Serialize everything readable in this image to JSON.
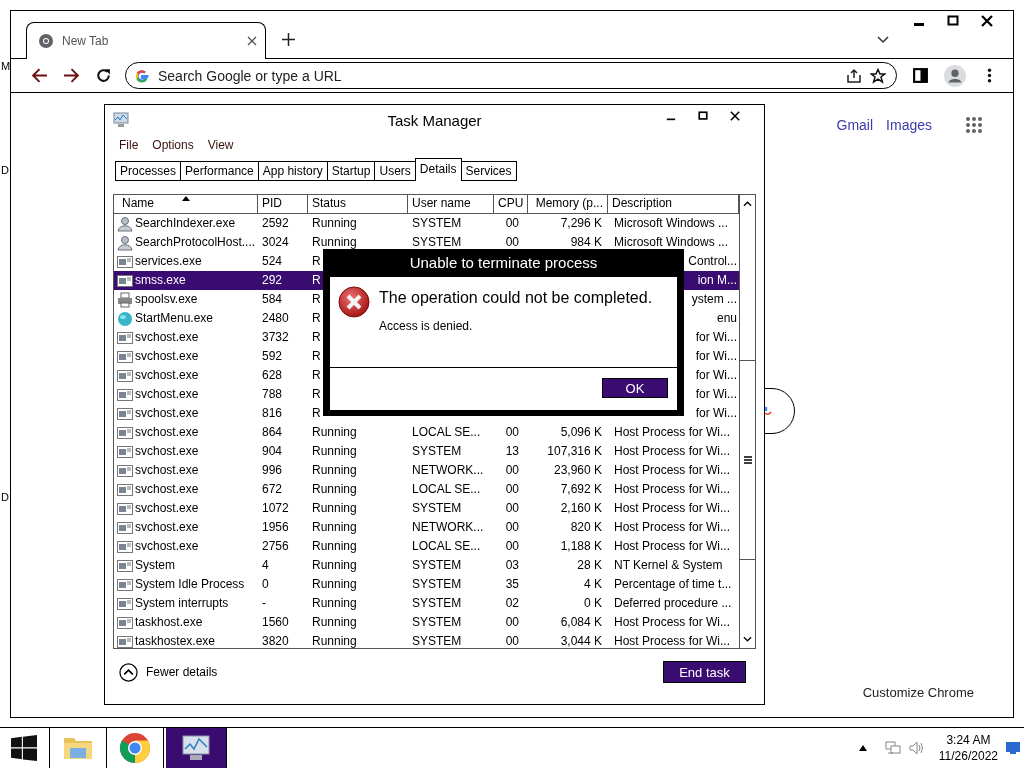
{
  "desktop": {
    "edge_letters": [
      "M",
      "D",
      "D"
    ]
  },
  "browser": {
    "tabs": [
      {
        "title": "New Tab",
        "selected": true
      }
    ],
    "omnibox": {
      "placeholder": "Search Google or type a URL"
    },
    "top_links": [
      "Gmail",
      "Images"
    ],
    "customize_button": "Customize Chrome"
  },
  "task_manager": {
    "title": "Task Manager",
    "menu": [
      "File",
      "Options",
      "View"
    ],
    "tabs": [
      {
        "label": "Processes",
        "selected": false
      },
      {
        "label": "Performance",
        "selected": false
      },
      {
        "label": "App history",
        "selected": false
      },
      {
        "label": "Startup",
        "selected": false
      },
      {
        "label": "Users",
        "selected": false
      },
      {
        "label": "Details",
        "selected": true
      },
      {
        "label": "Services",
        "selected": false
      }
    ],
    "columns": [
      {
        "label": "Name",
        "sorted": true
      },
      {
        "label": "PID",
        "sorted": false
      },
      {
        "label": "Status",
        "sorted": false
      },
      {
        "label": "User name",
        "sorted": false
      },
      {
        "label": "CPU",
        "sorted": false
      },
      {
        "label": "Memory (p...",
        "sorted": false
      },
      {
        "label": "Description",
        "sorted": false
      }
    ],
    "rows": [
      {
        "kind": "service",
        "name": "SearchIndexer.exe",
        "pid": "2592",
        "status": "Running",
        "user": "SYSTEM",
        "cpu": "00",
        "memory": "7,296 K",
        "description": "Microsoft Windows ...",
        "selected": false,
        "covered": false
      },
      {
        "kind": "service",
        "name": "SearchProtocolHost....",
        "pid": "3024",
        "status": "Running",
        "user": "SYSTEM",
        "cpu": "00",
        "memory": "984 K",
        "description": "Microsoft Windows ...",
        "selected": false,
        "covered": false
      },
      {
        "kind": "app",
        "name": "services.exe",
        "pid": "524",
        "status": "R",
        "description": "Control...",
        "selected": false,
        "covered": true
      },
      {
        "kind": "app",
        "name": "smss.exe",
        "pid": "292",
        "status": "R",
        "description": "ion M...",
        "selected": true,
        "covered": true
      },
      {
        "kind": "printer",
        "name": "spoolsv.exe",
        "pid": "584",
        "status": "R",
        "description": "ystem ...",
        "selected": false,
        "covered": true
      },
      {
        "kind": "globe",
        "name": "StartMenu.exe",
        "pid": "2480",
        "status": "R",
        "description": "enu",
        "selected": false,
        "covered": true
      },
      {
        "kind": "app",
        "name": "svchost.exe",
        "pid": "3732",
        "status": "R",
        "description": "for Wi...",
        "selected": false,
        "covered": true
      },
      {
        "kind": "app",
        "name": "svchost.exe",
        "pid": "592",
        "status": "R",
        "description": "for Wi...",
        "selected": false,
        "covered": true
      },
      {
        "kind": "app",
        "name": "svchost.exe",
        "pid": "628",
        "status": "R",
        "description": "for Wi...",
        "selected": false,
        "covered": true
      },
      {
        "kind": "app",
        "name": "svchost.exe",
        "pid": "788",
        "status": "R",
        "description": "for Wi...",
        "selected": false,
        "covered": true
      },
      {
        "kind": "app",
        "name": "svchost.exe",
        "pid": "816",
        "status": "R",
        "description": "for Wi...",
        "selected": false,
        "covered": true
      },
      {
        "kind": "app",
        "name": "svchost.exe",
        "pid": "864",
        "status": "Running",
        "user": "LOCAL SE...",
        "cpu": "00",
        "memory": "5,096 K",
        "description": "Host Process for Wi...",
        "selected": false,
        "covered": false
      },
      {
        "kind": "app",
        "name": "svchost.exe",
        "pid": "904",
        "status": "Running",
        "user": "SYSTEM",
        "cpu": "13",
        "memory": "107,316 K",
        "description": "Host Process for Wi...",
        "selected": false,
        "covered": false
      },
      {
        "kind": "app",
        "name": "svchost.exe",
        "pid": "996",
        "status": "Running",
        "user": "NETWORK...",
        "cpu": "00",
        "memory": "23,960 K",
        "description": "Host Process for Wi...",
        "selected": false,
        "covered": false
      },
      {
        "kind": "app",
        "name": "svchost.exe",
        "pid": "672",
        "status": "Running",
        "user": "LOCAL SE...",
        "cpu": "00",
        "memory": "7,692 K",
        "description": "Host Process for Wi...",
        "selected": false,
        "covered": false
      },
      {
        "kind": "app",
        "name": "svchost.exe",
        "pid": "1072",
        "status": "Running",
        "user": "SYSTEM",
        "cpu": "00",
        "memory": "2,160 K",
        "description": "Host Process for Wi...",
        "selected": false,
        "covered": false
      },
      {
        "kind": "app",
        "name": "svchost.exe",
        "pid": "1956",
        "status": "Running",
        "user": "NETWORK...",
        "cpu": "00",
        "memory": "820 K",
        "description": "Host Process for Wi...",
        "selected": false,
        "covered": false
      },
      {
        "kind": "app",
        "name": "svchost.exe",
        "pid": "2756",
        "status": "Running",
        "user": "LOCAL SE...",
        "cpu": "00",
        "memory": "1,188 K",
        "description": "Host Process for Wi...",
        "selected": false,
        "covered": false
      },
      {
        "kind": "app",
        "name": "System",
        "pid": "4",
        "status": "Running",
        "user": "SYSTEM",
        "cpu": "03",
        "memory": "28 K",
        "description": "NT Kernel & System",
        "selected": false,
        "covered": false
      },
      {
        "kind": "app",
        "name": "System Idle Process",
        "pid": "0",
        "status": "Running",
        "user": "SYSTEM",
        "cpu": "35",
        "memory": "4 K",
        "description": "Percentage of time t...",
        "selected": false,
        "covered": false
      },
      {
        "kind": "app",
        "name": "System interrupts",
        "pid": "-",
        "status": "Running",
        "user": "SYSTEM",
        "cpu": "02",
        "memory": "0 K",
        "description": "Deferred procedure ...",
        "selected": false,
        "covered": false
      },
      {
        "kind": "app",
        "name": "taskhost.exe",
        "pid": "1560",
        "status": "Running",
        "user": "SYSTEM",
        "cpu": "00",
        "memory": "6,084 K",
        "description": "Host Process for Wi...",
        "selected": false,
        "covered": false
      },
      {
        "kind": "app",
        "name": "taskhostex.exe",
        "pid": "3820",
        "status": "Running",
        "user": "SYSTEM",
        "cpu": "00",
        "memory": "3,044 K",
        "description": "Host Process for Wi...",
        "selected": false,
        "covered": false
      }
    ],
    "fewer_details": "Fewer details",
    "end_task": "End task"
  },
  "dialog": {
    "title": "Unable to terminate process",
    "message": "The operation could not be completed.",
    "detail": "Access is denied.",
    "button": "OK"
  },
  "taskbar": {
    "apps": [
      {
        "kind": "explorer",
        "selected": false
      },
      {
        "kind": "chrome",
        "selected": false
      },
      {
        "kind": "task-manager",
        "selected": true
      }
    ],
    "time": "3:24 AM",
    "date": "11/26/2022"
  }
}
